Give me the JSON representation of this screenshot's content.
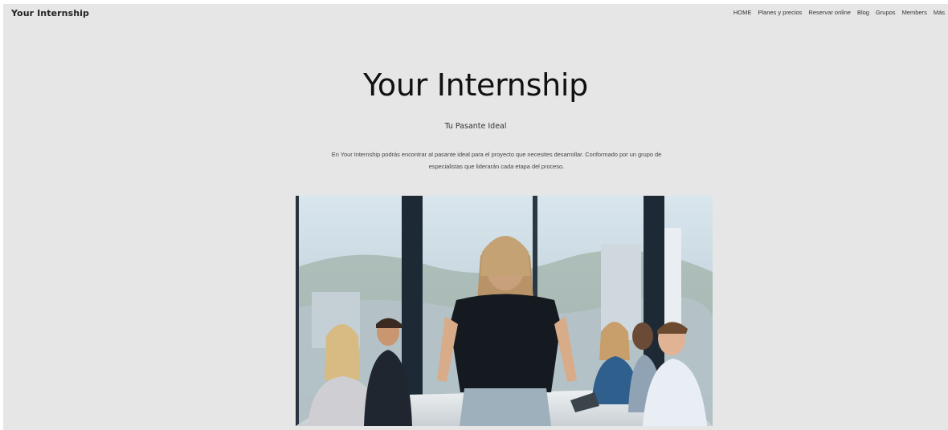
{
  "header": {
    "brand": "Your Internship",
    "nav": [
      "HOME",
      "Planes y precios",
      "Reservar online",
      "Blog",
      "Grupos",
      "Members",
      "Más"
    ]
  },
  "hero": {
    "title": "Your Internship",
    "subtitle": "Tu Pasante Ideal",
    "description": "En Your Internship podrás encontrar al pasante ideal para el proyecto que necesites desarrollar. Conformado por un grupo de especialistas que liderarán cada etapa del proceso."
  },
  "colors": {
    "page_background": "#e6e6e6",
    "text_primary": "#111111"
  }
}
